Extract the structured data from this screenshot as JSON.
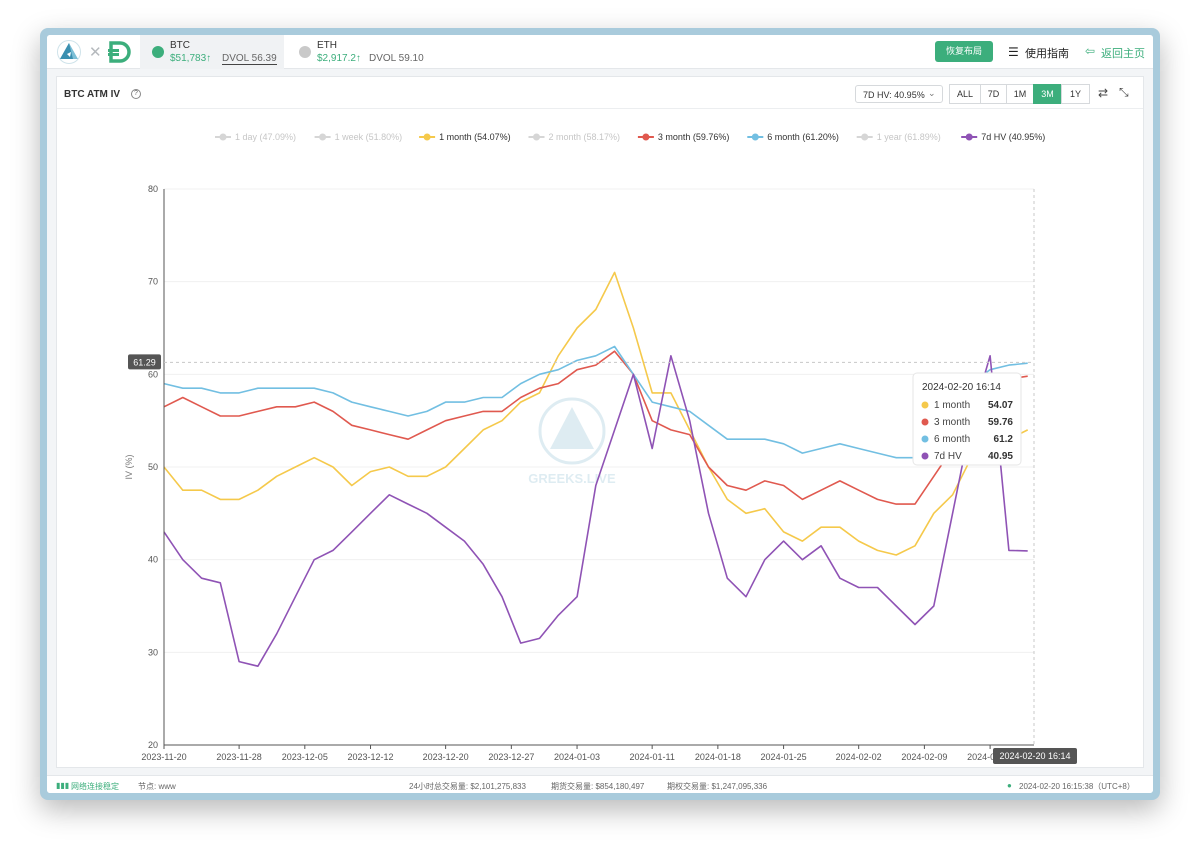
{
  "header": {
    "logo_icon": "greeks-live-triangle-logo",
    "partner_icon": "deribit-d-logo",
    "coins": [
      {
        "symbol": "BTC",
        "price": "$51,783↑",
        "dvol": "DVOL 56.39",
        "icon": "bitcoin-icon",
        "color": "#3cae7c"
      },
      {
        "symbol": "ETH",
        "price": "$2,917.2↑",
        "dvol": "DVOL 59.10",
        "icon": "ethereum-icon",
        "color": "#c9c9c9"
      }
    ],
    "restore_layout": "恢复布局",
    "guide": "使用指南",
    "guide_icon": "layers-icon",
    "home": "返回主页",
    "home_icon": "exit-icon"
  },
  "panel": {
    "title": "BTC ATM IV",
    "info_icon": "question-circle-icon",
    "hv_select": "7D HV: 40.95%",
    "timeframes": [
      {
        "label": "ALL",
        "selected": false
      },
      {
        "label": "7D",
        "selected": false
      },
      {
        "label": "1M",
        "selected": false
      },
      {
        "label": "3M",
        "selected": true
      },
      {
        "label": "1Y",
        "selected": false
      }
    ],
    "swap_icon": "swap-arrows-icon",
    "shrink_icon": "shrink-icon",
    "watermark": "GREEKS.LIVE"
  },
  "chart_data": {
    "type": "line",
    "title": "",
    "xlabel": "",
    "ylabel": "IV (%)",
    "ylim": [
      20,
      80
    ],
    "yticks": [
      20,
      30,
      40,
      50,
      60,
      70,
      80
    ],
    "x_ticks": [
      "2023-11-20",
      "2023-11-28",
      "2023-12-05",
      "2023-12-12",
      "2023-12-20",
      "2023-12-27",
      "2024-01-03",
      "2024-01-11",
      "2024-01-18",
      "2024-01-25",
      "2024-02-02",
      "2024-02-09",
      "2024-02-16"
    ],
    "x": [
      "2023-11-20",
      "2023-11-22",
      "2023-11-24",
      "2023-11-26",
      "2023-11-28",
      "2023-11-30",
      "2023-12-02",
      "2023-12-04",
      "2023-12-06",
      "2023-12-08",
      "2023-12-10",
      "2023-12-12",
      "2023-12-14",
      "2023-12-16",
      "2023-12-18",
      "2023-12-20",
      "2023-12-22",
      "2023-12-24",
      "2023-12-26",
      "2023-12-28",
      "2023-12-30",
      "2024-01-01",
      "2024-01-03",
      "2024-01-05",
      "2024-01-07",
      "2024-01-09",
      "2024-01-11",
      "2024-01-13",
      "2024-01-15",
      "2024-01-17",
      "2024-01-19",
      "2024-01-21",
      "2024-01-23",
      "2024-01-25",
      "2024-01-27",
      "2024-01-29",
      "2024-01-31",
      "2024-02-02",
      "2024-02-04",
      "2024-02-06",
      "2024-02-08",
      "2024-02-10",
      "2024-02-12",
      "2024-02-14",
      "2024-02-16",
      "2024-02-18",
      "2024-02-20"
    ],
    "legend_position": "top",
    "series": [
      {
        "name": "1 day (47.09%)",
        "color": "#cfcfcf",
        "enabled": false,
        "values": []
      },
      {
        "name": "1 week (51.80%)",
        "color": "#cfcfcf",
        "enabled": false,
        "values": []
      },
      {
        "name": "1 month (54.07%)",
        "color": "#f5c94b",
        "enabled": true,
        "values": [
          50,
          47.5,
          47.5,
          46.5,
          46.5,
          47.5,
          49,
          50,
          51,
          50,
          48,
          49.5,
          50,
          49,
          49,
          50,
          52,
          54,
          55,
          57,
          58,
          62,
          65,
          67,
          71,
          65,
          58,
          58,
          54,
          50,
          46.5,
          45,
          45.5,
          43,
          42,
          43.5,
          43.5,
          42,
          41,
          40.5,
          41.5,
          45,
          47,
          51,
          55,
          53,
          54
        ]
      },
      {
        "name": "2 month (58.17%)",
        "color": "#cfcfcf",
        "enabled": false,
        "values": []
      },
      {
        "name": "3 month (59.76%)",
        "color": "#e0594f",
        "enabled": true,
        "values": [
          56.5,
          57.5,
          56.5,
          55.5,
          55.5,
          56,
          56.5,
          56.5,
          57,
          56,
          54.5,
          54,
          53.5,
          53,
          54,
          55,
          55.5,
          56,
          56,
          57.5,
          58.5,
          59,
          60.5,
          61,
          62.5,
          60,
          55,
          54,
          53.5,
          50,
          48,
          47.5,
          48.5,
          48,
          46.5,
          47.5,
          48.5,
          47.5,
          46.5,
          46,
          46,
          49,
          52,
          56,
          58.5,
          59.5,
          59.8
        ]
      },
      {
        "name": "6 month (61.20%)",
        "color": "#72bfe2",
        "enabled": true,
        "values": [
          59,
          58.5,
          58.5,
          58,
          58,
          58.5,
          58.5,
          58.5,
          58.5,
          58,
          57,
          56.5,
          56,
          55.5,
          56,
          57,
          57,
          57.5,
          57.5,
          59,
          60,
          60.5,
          61.5,
          62,
          63,
          60,
          57,
          56.5,
          56,
          54.5,
          53,
          53,
          53,
          52.5,
          51.5,
          52,
          52.5,
          52,
          51.5,
          51,
          51,
          53,
          56,
          59,
          60.5,
          61,
          61.2
        ]
      },
      {
        "name": "1 year (61.89%)",
        "color": "#cfcfcf",
        "enabled": false,
        "values": []
      },
      {
        "name": "7d HV (40.95%)",
        "color": "#8f53b5",
        "enabled": true,
        "values": [
          43,
          40,
          38,
          37.5,
          29,
          28.5,
          32,
          36,
          40,
          41,
          43,
          45,
          47,
          46,
          45,
          43.5,
          42,
          39.5,
          36,
          31,
          31.5,
          34,
          36,
          48,
          54,
          60,
          52,
          62,
          55,
          45,
          38,
          36,
          40,
          42,
          40,
          41.5,
          38,
          37,
          37,
          35,
          33,
          35,
          45,
          55,
          62,
          41,
          40.95
        ]
      }
    ],
    "crosshair": {
      "y_value": 61.29,
      "x_label": "2024-02-20 16:14"
    },
    "tooltip": {
      "title": "2024-02-20 16:14",
      "rows": [
        {
          "label": "1 month",
          "value": "54.07",
          "color": "#f5c94b"
        },
        {
          "label": "3 month",
          "value": "59.76",
          "color": "#e0594f"
        },
        {
          "label": "6 month",
          "value": "61.2",
          "color": "#72bfe2"
        },
        {
          "label": "7d HV",
          "value": "40.95",
          "color": "#8f53b5"
        }
      ]
    }
  },
  "footer": {
    "net_icon": "signal-bars-icon",
    "network": "网络连接稳定",
    "node": "节点: www",
    "vol24": "24小时总交易量: $2,101,275,833",
    "spot": "期货交易量: $854,180,497",
    "options": "期权交易量: $1,247,095,336",
    "clock": "2024-02-20 16:15:38（UTC+8）"
  }
}
